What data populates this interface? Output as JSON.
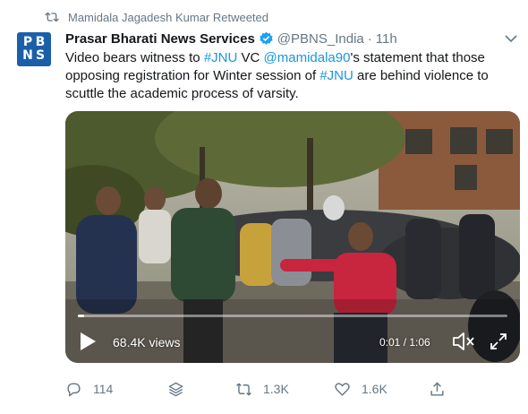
{
  "retweet": {
    "icon": "retweet-icon",
    "text": "Mamidala Jagadesh Kumar Retweeted"
  },
  "author": {
    "avatar_letters": [
      "P",
      "B",
      "N",
      "S"
    ],
    "avatar_color": "#1b5fa8",
    "name": "Prasar Bharati News Services",
    "verified": true,
    "handle": "@PBNS_India",
    "separator": "·",
    "time": "11h"
  },
  "tweet": {
    "segments": [
      {
        "text": "Video bears witness to ",
        "type": "text"
      },
      {
        "text": "#JNU",
        "type": "hashtag"
      },
      {
        "text": " VC ",
        "type": "text"
      },
      {
        "text": "@mamidala90",
        "type": "mention"
      },
      {
        "text": "'s statement that those opposing registration for Winter session of ",
        "type": "text"
      },
      {
        "text": "#JNU",
        "type": "hashtag"
      },
      {
        "text": " are behind violence to scuttle the academic process of varsity.",
        "type": "text"
      }
    ]
  },
  "video": {
    "views": "68.4K views",
    "time": "0:01 / 1:06",
    "progress": 0.015
  },
  "actions": {
    "reply_count": "114",
    "retweet_count": "1.3K",
    "like_count": "1.6K"
  },
  "colors": {
    "link": "#1b95e0",
    "muted": "#657786",
    "text": "#14171a",
    "verified": "#1da1f2"
  }
}
